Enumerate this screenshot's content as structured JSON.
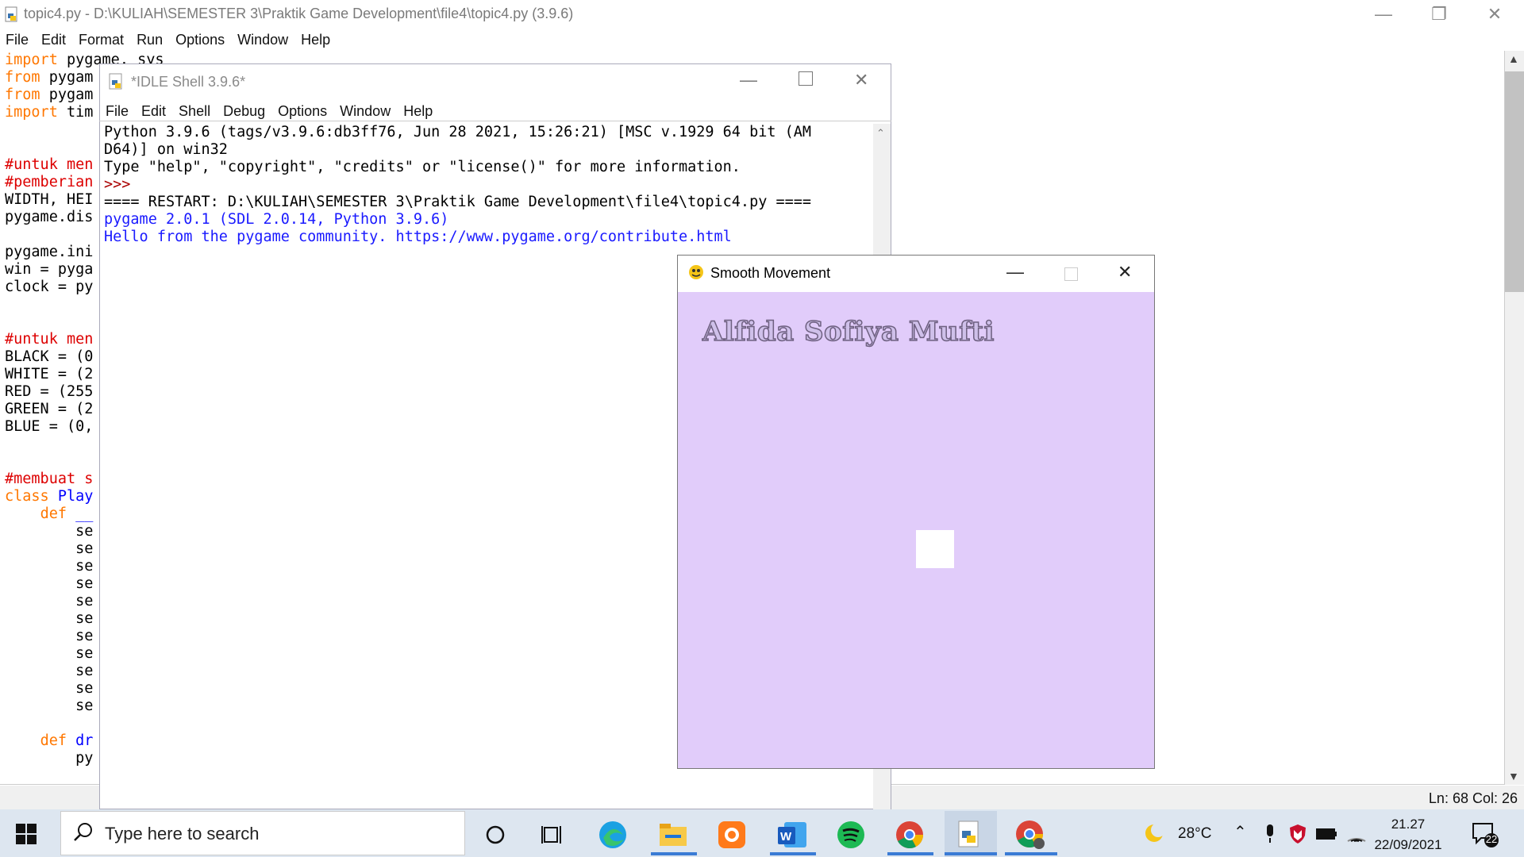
{
  "editor": {
    "title": "topic4.py - D:\\KULIAH\\SEMESTER 3\\Praktik Game Development\\file4\\topic4.py (3.9.6)",
    "menu": [
      "File",
      "Edit",
      "Format",
      "Run",
      "Options",
      "Window",
      "Help"
    ],
    "code_lines": [
      "import pygame, sys",
      "from pygam",
      "from pygam",
      "import tim",
      "",
      "",
      "#untuk men",
      "#pemberian",
      "WIDTH, HEI",
      "pygame.dis",
      "",
      "pygame.ini",
      "win = pyga",
      "clock = py",
      "",
      "",
      "#untuk men",
      "BLACK = (0",
      "WHITE = (2",
      "RED = (255",
      "GREEN = (2",
      "BLUE = (0,",
      "",
      "",
      "#membuat s",
      "class Play",
      "    def __",
      "        se",
      "        se",
      "        se",
      "        se",
      "        se",
      "        se",
      "        se",
      "        se",
      "        se",
      "        se",
      "        se",
      "",
      "    def dr",
      "        py"
    ],
    "status": "Ln: 68   Col: 26"
  },
  "shell": {
    "title": "*IDLE Shell 3.9.6*",
    "menu": [
      "File",
      "Edit",
      "Shell",
      "Debug",
      "Options",
      "Window",
      "Help"
    ],
    "line1": "Python 3.9.6 (tags/v3.9.6:db3ff76, Jun 28 2021, 15:26:21) [MSC v.1929 64 bit (AM",
    "line2": "D64)] on win32",
    "line3": "Type \"help\", \"copyright\", \"credits\" or \"license()\" for more information.",
    "prompt": ">>> ",
    "restart": "==== RESTART: D:\\KULIAH\\SEMESTER 3\\Praktik Game Development\\file4\\topic4.py ====",
    "out1": "pygame 2.0.1 (SDL 2.0.14, Python 3.9.6)",
    "out2": "Hello from the pygame community. https://www.pygame.org/contribute.html"
  },
  "game": {
    "title": "Smooth Movement",
    "player_name": "Alfida Sofiya Mufti",
    "bg_color": "#e1ccfa",
    "player_color": "#ffffff"
  },
  "taskbar": {
    "search_placeholder": "Type here to search",
    "icons": [
      "cortana-icon",
      "task-view-icon",
      "edge-icon",
      "file-explorer-icon",
      "uc-browser-icon",
      "word-icon",
      "spotify-icon",
      "chrome-icon",
      "python-idle-icon",
      "chrome-profile-icon"
    ],
    "temperature": "28°C",
    "time": "21.27",
    "date": "22/09/2021",
    "notification_count": "22"
  }
}
